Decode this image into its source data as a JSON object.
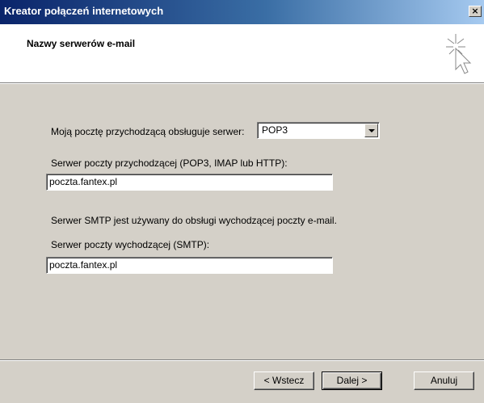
{
  "window": {
    "title": "Kreator połączeń internetowych",
    "close_label": "×"
  },
  "header": {
    "title": "Nazwy serwerów e-mail",
    "icon": "wizard-sparkle-cursor-icon"
  },
  "form": {
    "incoming_server_type_label": "Moją pocztę przychodzącą obsługuje serwer:",
    "incoming_server_type_value": "POP3",
    "incoming_server_label": "Serwer poczty przychodzącej (POP3, IMAP lub HTTP):",
    "incoming_server_value": "poczta.fantex.pl",
    "smtp_note": "Serwer SMTP jest używany do obsługi wychodzącej poczty e-mail.",
    "outgoing_server_label": "Serwer poczty wychodzącej (SMTP):",
    "outgoing_server_value": "poczta.fantex.pl"
  },
  "buttons": {
    "back": "< Wstecz",
    "next": "Dalej >",
    "cancel": "Anuluj"
  },
  "colors": {
    "titlebar_start": "#0a246a",
    "titlebar_end": "#a6caf0",
    "dialog_face": "#d4d0c8",
    "header_bg": "#ffffff"
  }
}
